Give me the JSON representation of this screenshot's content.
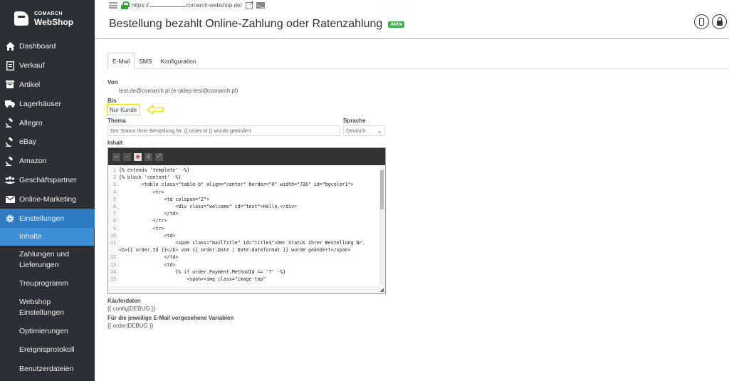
{
  "brand": {
    "line1": "COMARCH",
    "line2": "WebShop"
  },
  "sidebar": {
    "items": [
      {
        "label": "Dashboard",
        "icon": "home-icon"
      },
      {
        "label": "Verkauf",
        "icon": "document-icon"
      },
      {
        "label": "Artikel",
        "icon": "box-icon"
      },
      {
        "label": "Lagerhäuser",
        "icon": "truck-icon"
      },
      {
        "label": "Allegro",
        "icon": "gavel-icon"
      },
      {
        "label": "eBay",
        "icon": "gavel-icon"
      },
      {
        "label": "Amazon",
        "icon": "gavel-icon"
      },
      {
        "label": "Geschäftspartner",
        "icon": "users-icon"
      },
      {
        "label": "Online-Marketing",
        "icon": "envelope-icon"
      },
      {
        "label": "Einstellungen",
        "icon": "gear-icon"
      }
    ],
    "subitems": [
      {
        "label": "Inhalte"
      },
      {
        "label": "Zahlungen und Lieferungen"
      },
      {
        "label": "Treuprogramm"
      },
      {
        "label": "Webshop Einstellungen"
      },
      {
        "label": "Optimierungen"
      },
      {
        "label": "Ereignisprotokoll"
      },
      {
        "label": "Benutzerdateien"
      }
    ]
  },
  "header": {
    "url_prefix": "https://",
    "url_suffix": "comarch-webshop.de/",
    "title": "Bestellung bezahlt Online-Zahlung oder Ratenzahlung",
    "badge": "Aktiv"
  },
  "tabs": [
    {
      "label": "E-Mail"
    },
    {
      "label": "SMS"
    },
    {
      "label": "Konfiguration"
    }
  ],
  "form": {
    "von_label": "Von",
    "von_value": "test.de@comarch.pl (e-sklep-test@comarch.pl)",
    "bis_label": "Bis",
    "bis_value": "Nur Kunde",
    "thema_label": "Thema",
    "thema_value": "Der Status Ihrer Bestellung Nr. {{ order.Id }} wurde geändert",
    "sprache_label": "Sprache",
    "sprache_value": "Deutsch",
    "inhalt_label": "Inhalt",
    "kaeuferdaten_label": "Käuferdaten",
    "kaeuferdaten_value": "{{ config|DEBUG }}",
    "variablen_label": "Für die jeweilige E-Mail vorgesehene Variablen",
    "variablen_value": "{{ order|DEBUG }}"
  },
  "editor": {
    "lines": [
      {
        "n": "1",
        "t": "{% extends 'template' -%}"
      },
      {
        "n": "2",
        "t": "{% block 'content' -%}"
      },
      {
        "n": "3",
        "t": "        <table class=\"table-b\" align=\"center\" border=\"0\" width=\"736\" id=\"bgcolor1\">"
      },
      {
        "n": "4",
        "t": "            <tr>"
      },
      {
        "n": "5",
        "t": "                <td colspan=\"2\">"
      },
      {
        "n": "6",
        "t": "                    <div class=\"welcome\" id=\"text\">Hallo,</div>"
      },
      {
        "n": "7",
        "t": "                </td>"
      },
      {
        "n": "8",
        "t": "            </tr>"
      },
      {
        "n": "9",
        "t": "            <tr>"
      },
      {
        "n": "10",
        "t": "                <td>"
      },
      {
        "n": "11",
        "t": "                    <span class=\"mailTitle\" id=\"title3\">Der Status Ihrer Bestellung Nr."
      },
      {
        "n": "",
        "t": "<b>{{ order.Id }}</b> vom {{ order.Date | Date:dateformat }} wurde geändert</span>"
      },
      {
        "n": "12",
        "t": "                </td>"
      },
      {
        "n": "13",
        "t": "                <td>"
      },
      {
        "n": "14",
        "t": "                    {% if order.Payment.MethodId == '7' -%}"
      },
      {
        "n": "15",
        "t": "                        <span><img class=\"image-top\""
      }
    ]
  }
}
